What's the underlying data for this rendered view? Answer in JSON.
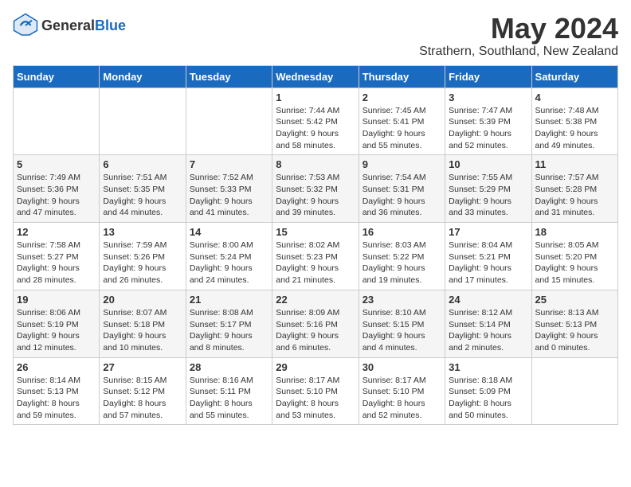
{
  "logo": {
    "general": "General",
    "blue": "Blue"
  },
  "title": "May 2024",
  "location": "Strathern, Southland, New Zealand",
  "days_of_week": [
    "Sunday",
    "Monday",
    "Tuesday",
    "Wednesday",
    "Thursday",
    "Friday",
    "Saturday"
  ],
  "weeks": [
    [
      {
        "day": "",
        "info": ""
      },
      {
        "day": "",
        "info": ""
      },
      {
        "day": "",
        "info": ""
      },
      {
        "day": "1",
        "info": "Sunrise: 7:44 AM\nSunset: 5:42 PM\nDaylight: 9 hours\nand 58 minutes."
      },
      {
        "day": "2",
        "info": "Sunrise: 7:45 AM\nSunset: 5:41 PM\nDaylight: 9 hours\nand 55 minutes."
      },
      {
        "day": "3",
        "info": "Sunrise: 7:47 AM\nSunset: 5:39 PM\nDaylight: 9 hours\nand 52 minutes."
      },
      {
        "day": "4",
        "info": "Sunrise: 7:48 AM\nSunset: 5:38 PM\nDaylight: 9 hours\nand 49 minutes."
      }
    ],
    [
      {
        "day": "5",
        "info": "Sunrise: 7:49 AM\nSunset: 5:36 PM\nDaylight: 9 hours\nand 47 minutes."
      },
      {
        "day": "6",
        "info": "Sunrise: 7:51 AM\nSunset: 5:35 PM\nDaylight: 9 hours\nand 44 minutes."
      },
      {
        "day": "7",
        "info": "Sunrise: 7:52 AM\nSunset: 5:33 PM\nDaylight: 9 hours\nand 41 minutes."
      },
      {
        "day": "8",
        "info": "Sunrise: 7:53 AM\nSunset: 5:32 PM\nDaylight: 9 hours\nand 39 minutes."
      },
      {
        "day": "9",
        "info": "Sunrise: 7:54 AM\nSunset: 5:31 PM\nDaylight: 9 hours\nand 36 minutes."
      },
      {
        "day": "10",
        "info": "Sunrise: 7:55 AM\nSunset: 5:29 PM\nDaylight: 9 hours\nand 33 minutes."
      },
      {
        "day": "11",
        "info": "Sunrise: 7:57 AM\nSunset: 5:28 PM\nDaylight: 9 hours\nand 31 minutes."
      }
    ],
    [
      {
        "day": "12",
        "info": "Sunrise: 7:58 AM\nSunset: 5:27 PM\nDaylight: 9 hours\nand 28 minutes."
      },
      {
        "day": "13",
        "info": "Sunrise: 7:59 AM\nSunset: 5:26 PM\nDaylight: 9 hours\nand 26 minutes."
      },
      {
        "day": "14",
        "info": "Sunrise: 8:00 AM\nSunset: 5:24 PM\nDaylight: 9 hours\nand 24 minutes."
      },
      {
        "day": "15",
        "info": "Sunrise: 8:02 AM\nSunset: 5:23 PM\nDaylight: 9 hours\nand 21 minutes."
      },
      {
        "day": "16",
        "info": "Sunrise: 8:03 AM\nSunset: 5:22 PM\nDaylight: 9 hours\nand 19 minutes."
      },
      {
        "day": "17",
        "info": "Sunrise: 8:04 AM\nSunset: 5:21 PM\nDaylight: 9 hours\nand 17 minutes."
      },
      {
        "day": "18",
        "info": "Sunrise: 8:05 AM\nSunset: 5:20 PM\nDaylight: 9 hours\nand 15 minutes."
      }
    ],
    [
      {
        "day": "19",
        "info": "Sunrise: 8:06 AM\nSunset: 5:19 PM\nDaylight: 9 hours\nand 12 minutes."
      },
      {
        "day": "20",
        "info": "Sunrise: 8:07 AM\nSunset: 5:18 PM\nDaylight: 9 hours\nand 10 minutes."
      },
      {
        "day": "21",
        "info": "Sunrise: 8:08 AM\nSunset: 5:17 PM\nDaylight: 9 hours\nand 8 minutes."
      },
      {
        "day": "22",
        "info": "Sunrise: 8:09 AM\nSunset: 5:16 PM\nDaylight: 9 hours\nand 6 minutes."
      },
      {
        "day": "23",
        "info": "Sunrise: 8:10 AM\nSunset: 5:15 PM\nDaylight: 9 hours\nand 4 minutes."
      },
      {
        "day": "24",
        "info": "Sunrise: 8:12 AM\nSunset: 5:14 PM\nDaylight: 9 hours\nand 2 minutes."
      },
      {
        "day": "25",
        "info": "Sunrise: 8:13 AM\nSunset: 5:13 PM\nDaylight: 9 hours\nand 0 minutes."
      }
    ],
    [
      {
        "day": "26",
        "info": "Sunrise: 8:14 AM\nSunset: 5:13 PM\nDaylight: 8 hours\nand 59 minutes."
      },
      {
        "day": "27",
        "info": "Sunrise: 8:15 AM\nSunset: 5:12 PM\nDaylight: 8 hours\nand 57 minutes."
      },
      {
        "day": "28",
        "info": "Sunrise: 8:16 AM\nSunset: 5:11 PM\nDaylight: 8 hours\nand 55 minutes."
      },
      {
        "day": "29",
        "info": "Sunrise: 8:17 AM\nSunset: 5:10 PM\nDaylight: 8 hours\nand 53 minutes."
      },
      {
        "day": "30",
        "info": "Sunrise: 8:17 AM\nSunset: 5:10 PM\nDaylight: 8 hours\nand 52 minutes."
      },
      {
        "day": "31",
        "info": "Sunrise: 8:18 AM\nSunset: 5:09 PM\nDaylight: 8 hours\nand 50 minutes."
      },
      {
        "day": "",
        "info": ""
      }
    ]
  ]
}
